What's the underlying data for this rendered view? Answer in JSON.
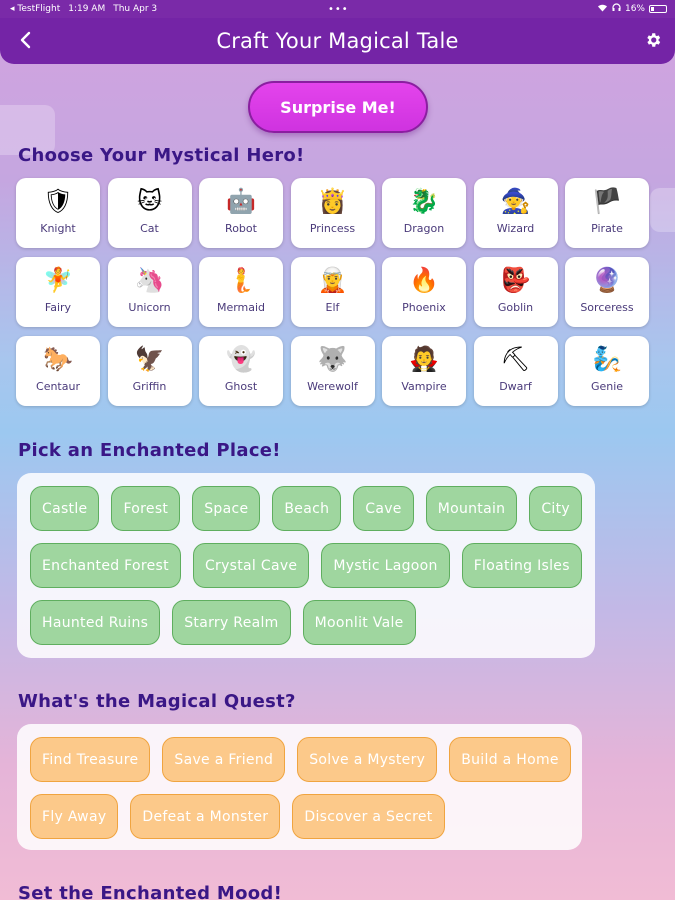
{
  "status_bar": {
    "carrier": "◂ TestFlight",
    "time": "1:19 AM",
    "date": "Thu Apr 3",
    "dots": "•••",
    "battery": "16%"
  },
  "header": {
    "title": "Craft Your Magical Tale",
    "back_icon": "chevron-left-icon",
    "settings_icon": "gear-icon"
  },
  "surprise_button": {
    "label": "Surprise Me!"
  },
  "heroes": {
    "title": "Choose Your Mystical Hero!",
    "items": [
      {
        "label": "Knight",
        "emoji": "🛡"
      },
      {
        "label": "Cat",
        "emoji": "🐱"
      },
      {
        "label": "Robot",
        "emoji": "🤖"
      },
      {
        "label": "Princess",
        "emoji": "👸"
      },
      {
        "label": "Dragon",
        "emoji": "🐉"
      },
      {
        "label": "Wizard",
        "emoji": "🧙"
      },
      {
        "label": "Pirate",
        "emoji": "🏴"
      },
      {
        "label": "Fairy",
        "emoji": "🧚"
      },
      {
        "label": "Unicorn",
        "emoji": "🦄"
      },
      {
        "label": "Mermaid",
        "emoji": "🧜"
      },
      {
        "label": "Elf",
        "emoji": "🧝"
      },
      {
        "label": "Phoenix",
        "emoji": "🔥"
      },
      {
        "label": "Goblin",
        "emoji": "👺"
      },
      {
        "label": "Sorceress",
        "emoji": "🔮"
      },
      {
        "label": "Centaur",
        "emoji": "🐎"
      },
      {
        "label": "Griffin",
        "emoji": "🦅"
      },
      {
        "label": "Ghost",
        "emoji": "👻"
      },
      {
        "label": "Werewolf",
        "emoji": "🐺"
      },
      {
        "label": "Vampire",
        "emoji": "🧛"
      },
      {
        "label": "Dwarf",
        "emoji": "⛏"
      },
      {
        "label": "Genie",
        "emoji": "🧞"
      }
    ]
  },
  "places": {
    "title": "Pick an Enchanted Place!",
    "items": [
      "Castle",
      "Forest",
      "Space",
      "Beach",
      "Cave",
      "Mountain",
      "City",
      "Enchanted Forest",
      "Crystal Cave",
      "Mystic Lagoon",
      "Floating Isles",
      "Haunted Ruins",
      "Starry Realm",
      "Moonlit Vale"
    ]
  },
  "quests": {
    "title": "What's the Magical Quest?",
    "items": [
      "Find Treasure",
      "Save a Friend",
      "Solve a Mystery",
      "Build a Home",
      "Fly Away",
      "Defeat a Monster",
      "Discover a Secret"
    ]
  },
  "mood": {
    "title": "Set the Enchanted Mood!"
  },
  "colors": {
    "header_bg": "#7424a6",
    "accent_button": "#d83ce6",
    "section_title": "#3a1786",
    "place_chip": "#9fd69f",
    "quest_chip": "#fcc98a"
  }
}
